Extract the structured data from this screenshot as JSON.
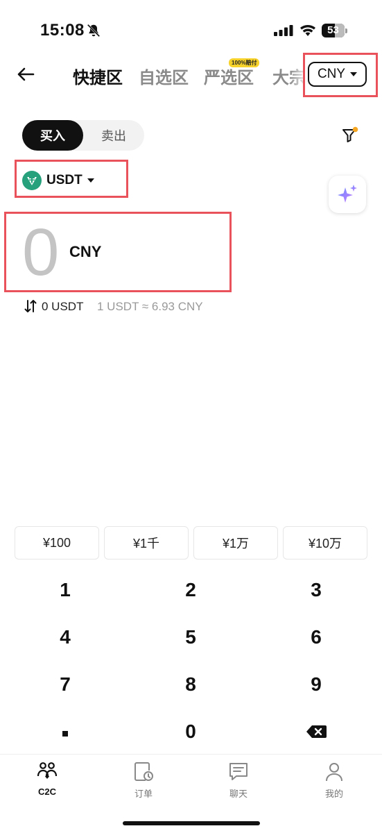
{
  "status_bar": {
    "time": "15:08",
    "battery": "53"
  },
  "header": {
    "tabs": [
      {
        "label": "快捷区",
        "active": true
      },
      {
        "label": "自选区",
        "active": false
      },
      {
        "label": "严选区",
        "active": false
      },
      {
        "label": "大宗",
        "active": false
      }
    ],
    "badge": "100%赔付",
    "currency": "CNY"
  },
  "trade": {
    "buy_label": "买入",
    "sell_label": "卖出",
    "coin": "USDT",
    "amount": "0",
    "amount_unit": "CNY",
    "converted": "0 USDT",
    "rate": "1 USDT ≈ 6.93 CNY"
  },
  "quick_amounts": [
    "¥100",
    "¥1千",
    "¥1万",
    "¥10万"
  ],
  "keypad": [
    "1",
    "2",
    "3",
    "4",
    "5",
    "6",
    "7",
    "8",
    "9",
    ".",
    "0",
    "⌫"
  ],
  "nav": [
    {
      "label": "C2C",
      "icon": "people-icon",
      "active": true
    },
    {
      "label": "订单",
      "icon": "order-icon",
      "active": false
    },
    {
      "label": "聊天",
      "icon": "chat-icon",
      "active": false
    },
    {
      "label": "我的",
      "icon": "profile-icon",
      "active": false
    }
  ],
  "colors": {
    "highlight": "#e9525a",
    "accent": "#111111",
    "badge": "#f7d22a",
    "tether": "#26a17b"
  }
}
